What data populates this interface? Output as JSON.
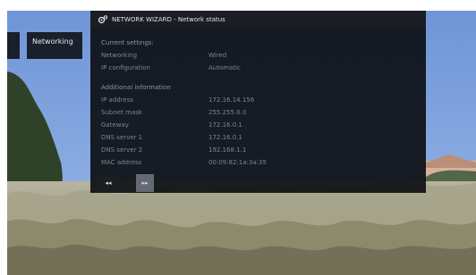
{
  "sidebar": {
    "main_label": "Networking"
  },
  "window": {
    "title": "NETWORK WIZARD - Network status"
  },
  "current_settings": {
    "heading": "Current settings:",
    "rows": [
      {
        "label": "Networking",
        "value": "Wired"
      },
      {
        "label": "IP configuration",
        "value": "Automatic"
      }
    ]
  },
  "additional_info": {
    "heading": "Additional information",
    "rows": [
      {
        "label": "IP address",
        "value": "172.16.14.156"
      },
      {
        "label": "Subnet mask",
        "value": "255.255.0.0"
      },
      {
        "label": "Gateway",
        "value": "172.16.0.1"
      },
      {
        "label": "DNS server 1",
        "value": "172.16.0.1"
      },
      {
        "label": "DNS server 2",
        "value": "192.168.1.1"
      },
      {
        "label": "MAC address",
        "value": "00:09:82:1a:3a:35"
      }
    ]
  },
  "nav": {
    "prev_label": "◂◂",
    "next_label": "▸▸"
  },
  "icons": {
    "settings_gear": "gear-icon"
  }
}
